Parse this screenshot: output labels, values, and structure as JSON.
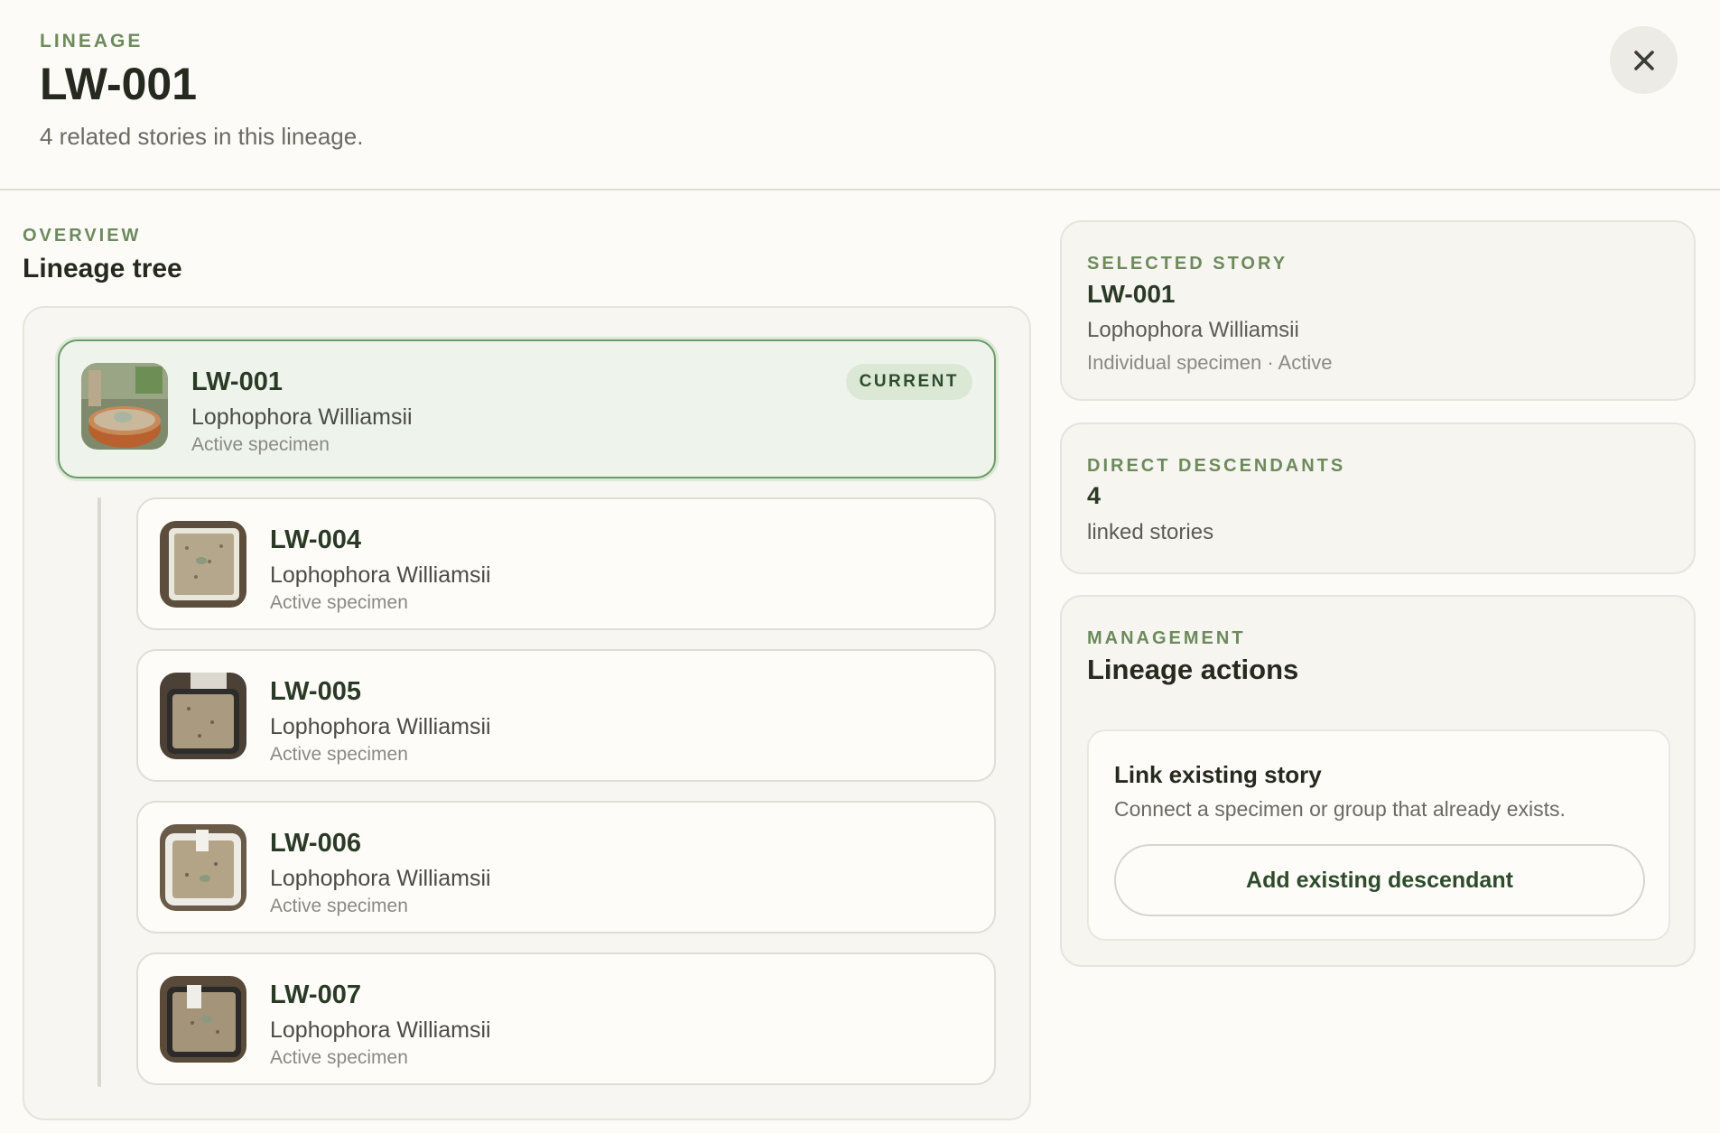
{
  "header": {
    "eyebrow": "LINEAGE",
    "title": "LW-001",
    "subtitle": "4 related stories in this lineage."
  },
  "overview": {
    "eyebrow": "OVERVIEW",
    "title": "Lineage tree"
  },
  "tree": {
    "current": {
      "code": "LW-001",
      "species": "Lophophora Williamsii",
      "status": "Active specimen",
      "badge": "CURRENT"
    },
    "descendants": [
      {
        "code": "LW-004",
        "species": "Lophophora Williamsii",
        "status": "Active specimen"
      },
      {
        "code": "LW-005",
        "species": "Lophophora Williamsii",
        "status": "Active specimen"
      },
      {
        "code": "LW-006",
        "species": "Lophophora Williamsii",
        "status": "Active specimen"
      },
      {
        "code": "LW-007",
        "species": "Lophophora Williamsii",
        "status": "Active specimen"
      }
    ]
  },
  "selected_story": {
    "eyebrow": "SELECTED STORY",
    "code": "LW-001",
    "species": "Lophophora Williamsii",
    "meta": "Individual specimen · Active"
  },
  "direct_descendants": {
    "eyebrow": "DIRECT DESCENDANTS",
    "count": "4",
    "label": "linked stories"
  },
  "management": {
    "eyebrow": "MANAGEMENT",
    "title": "Lineage actions",
    "link_title": "Link existing story",
    "link_desc": "Connect a specimen or group that already exists.",
    "button_label": "Add existing descendant"
  },
  "colors": {
    "accent": "#6d8a5c",
    "current_bg": "#eef4ec",
    "current_border": "#6e9a6a",
    "text_dark_green": "#2b3a26"
  },
  "icons": {
    "close": "close-icon"
  }
}
